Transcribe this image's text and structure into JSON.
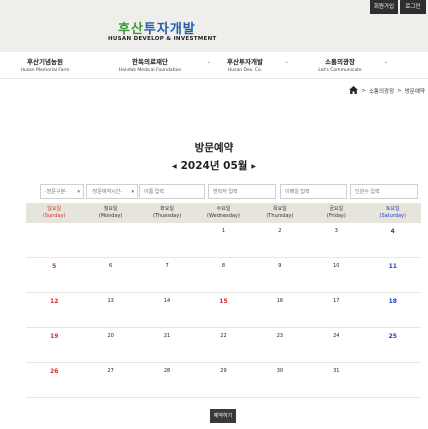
{
  "header": {
    "logo_ko_part1": "후산",
    "logo_ko_part2": "투자개발",
    "logo_en": "HUSAN DEVELOP & INVESTMENT",
    "join_label": "회원가입",
    "login_label": "로그인"
  },
  "nav": {
    "items": [
      {
        "label": "후산기념농원",
        "sub": "Husan Memorial Farm"
      },
      {
        "label": "한독의료재단",
        "sub": "Handok Medical Foundation"
      },
      {
        "label": "후산투자개발",
        "sub": "Husan Dev. Co."
      },
      {
        "label": "소통의광장",
        "sub": "Let's Communicate"
      }
    ]
  },
  "breadcrumb": {
    "sep1": ">",
    "level1": "소통의광장",
    "sep2": ">",
    "level2": "방문예약"
  },
  "page": {
    "title": "방문예약",
    "month_label": "2024년 05월",
    "prev_arrow": "◀",
    "next_arrow": "▶"
  },
  "filters": {
    "select1": "-방문구분-",
    "select2": "-방문예약시간-",
    "name_placeholder": "이름 입력",
    "phone_placeholder": "연락처 입력",
    "email_placeholder": "이메일 입력",
    "people_placeholder": "인원수 입력"
  },
  "calendar": {
    "days": [
      {
        "ko": "일요일",
        "en": "(Sunday)"
      },
      {
        "ko": "월요일",
        "en": "(Monday)"
      },
      {
        "ko": "화요일",
        "en": "(Thuesday)"
      },
      {
        "ko": "수요일",
        "en": "(Wednesday)"
      },
      {
        "ko": "목요일",
        "en": "(Thursday)"
      },
      {
        "ko": "금요일",
        "en": "(Friday)"
      },
      {
        "ko": "토요일",
        "en": "(Saturday)"
      }
    ],
    "weeks": [
      [
        "",
        "",
        "",
        "1",
        "2",
        "3",
        "4"
      ],
      [
        "5",
        "6",
        "7",
        "8",
        "9",
        "10",
        "11"
      ],
      [
        "12",
        "13",
        "14",
        "15",
        "16",
        "17",
        "18"
      ],
      [
        "19",
        "20",
        "21",
        "22",
        "23",
        "24",
        "25"
      ],
      [
        "26",
        "27",
        "28",
        "29",
        "30",
        "31",
        ""
      ]
    ],
    "holiday_dates": [
      "15"
    ]
  },
  "footer": {
    "reserve_label": "예약하기"
  }
}
